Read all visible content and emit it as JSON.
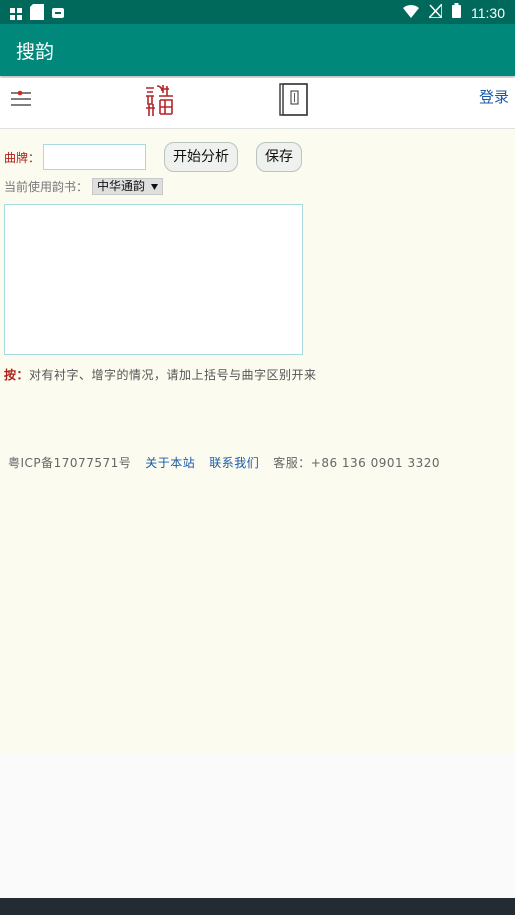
{
  "statusbar": {
    "time": "11:30"
  },
  "appbar": {
    "title": "搜韵"
  },
  "navbar": {
    "login": "登录"
  },
  "form": {
    "qupai_label": "曲牌：",
    "qupai_value": "",
    "analyze_button": "开始分析",
    "save_button": "保存",
    "rhyme_book_label": "当前使用韵书：",
    "rhyme_book_selected": "中华通韵",
    "lyrics_value": ""
  },
  "note": {
    "prefix": "按：",
    "text": "对有衬字、增字的情况，请加上括号与曲字区别开来"
  },
  "footer": {
    "icp": "粤ICP备17077571号",
    "about": "关于本站",
    "contact": "联系我们",
    "service": "客服：+86 136 0901 3320"
  },
  "colors": {
    "statusbar": "#00695c",
    "appbar": "#00897b",
    "content_bg": "#fbfbf0",
    "link": "#1a5aa6",
    "label": "#b0201a"
  }
}
